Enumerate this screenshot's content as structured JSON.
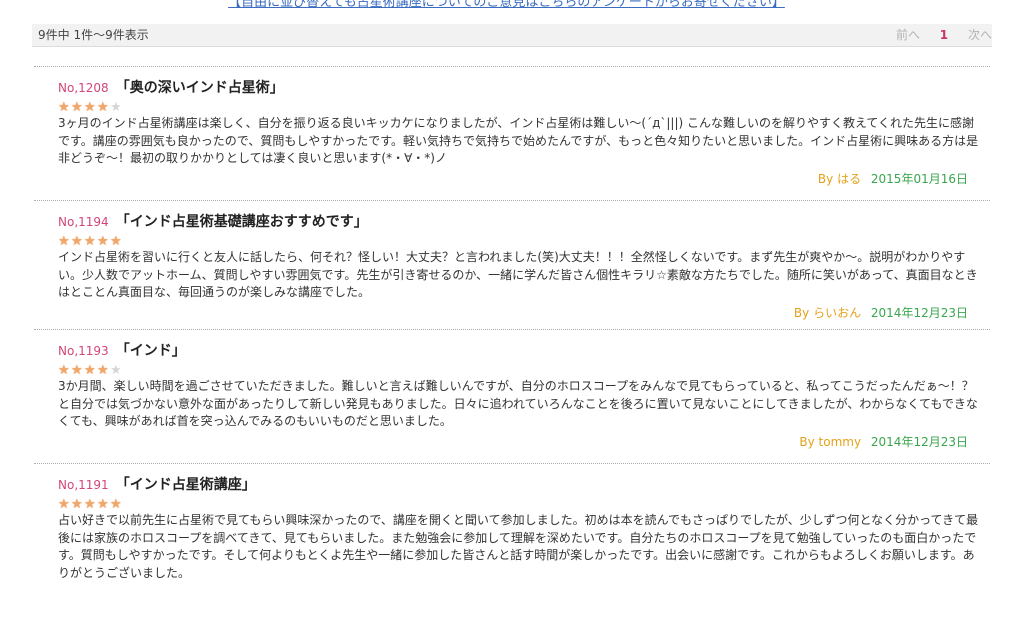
{
  "top_link": "【自由に並び替えても占星術講座についてのご意見はこちらのアンケートからお寄せください】",
  "pager": {
    "count_text": "9件中  1件～9件表示",
    "prev_label": "前へ",
    "current_page": "1",
    "next_label": "次へ"
  },
  "reviews": [
    {
      "no": "No,1208",
      "title": "「奥の深いインド占星術」",
      "rating": 4,
      "body": "3ヶ月のインド占星術講座は楽しく、自分を振り返る良いキッカケになりましたが、インド占星術は難しい〜(´д`|||) こんな難しいのを解りやすく教えてくれた先生に感謝です。講座の雰囲気も良かったので、質問もしやすかったです。軽い気持ちで気持ちで始めたんですが、もっと色々知りたいと思いました。インド占星術に興味ある方は是非どうぞ〜！最初の取りかかりとしては凄く良いと思います(*・∀・*)ノ",
      "author": "By はる",
      "date": "2015年01月16日"
    },
    {
      "no": "No,1194",
      "title": "「インド占星術基礎講座おすすめです」",
      "rating": 5,
      "body": "インド占星術を習いに行くと友人に話したら、何それ？怪しい！大丈夫？と言われました(笑)大丈夫！！！全然怪しくないです。まず先生が爽やか〜。説明がわかりやすい。少人数でアットホーム、質問しやすい雰囲気です。先生が引き寄せるのか、一緒に学んだ皆さん個性キラリ☆素敵な方たちでした。随所に笑いがあって、真面目なときはとことん真面目な、毎回通うのが楽しみな講座でした。",
      "author": "By らいおん",
      "date": "2014年12月23日"
    },
    {
      "no": "No,1193",
      "title": "「インド」",
      "rating": 4,
      "body": "3か月間、楽しい時間を過ごさせていただきました。難しいと言えば難しいんですが、自分のホロスコープをみんなで見てもらっていると、私ってこうだったんだぁ〜！？と自分では気づかない意外な面があったりして新しい発見もありました。日々に追われていろんなことを後ろに置いて見ないことにしてきましたが、わからなくてもできなくても、興味があれば首を突っ込んでみるのもいいものだと思いました。",
      "author": "By tommy",
      "date": "2014年12月23日"
    },
    {
      "no": "No,1191",
      "title": "「インド占星術講座」",
      "rating": 5,
      "body": "占い好きで以前先生に占星術で見てもらい興味深かったので、講座を開くと聞いて参加しました。初めは本を読んでもさっぱりでしたが、少しずつ何となく分かってきて最後には家族のホロスコープを調べてきて、見てもらいました。また勉強会に参加して理解を深めたいです。自分たちのホロスコープを見て勉強していったのも面白かったです。質問もしやすかったです。そして何よりもとくよ先生や一緒に参加した皆さんと話す時間が楽しかったです。出会いに感謝です。これからもよろしくお願いします。ありがとうございました。",
      "author": "",
      "date": ""
    }
  ],
  "colors": {
    "number": "#d2467c",
    "author": "#e4a21b",
    "date": "#3aa64e",
    "star": "#f0a86a"
  }
}
